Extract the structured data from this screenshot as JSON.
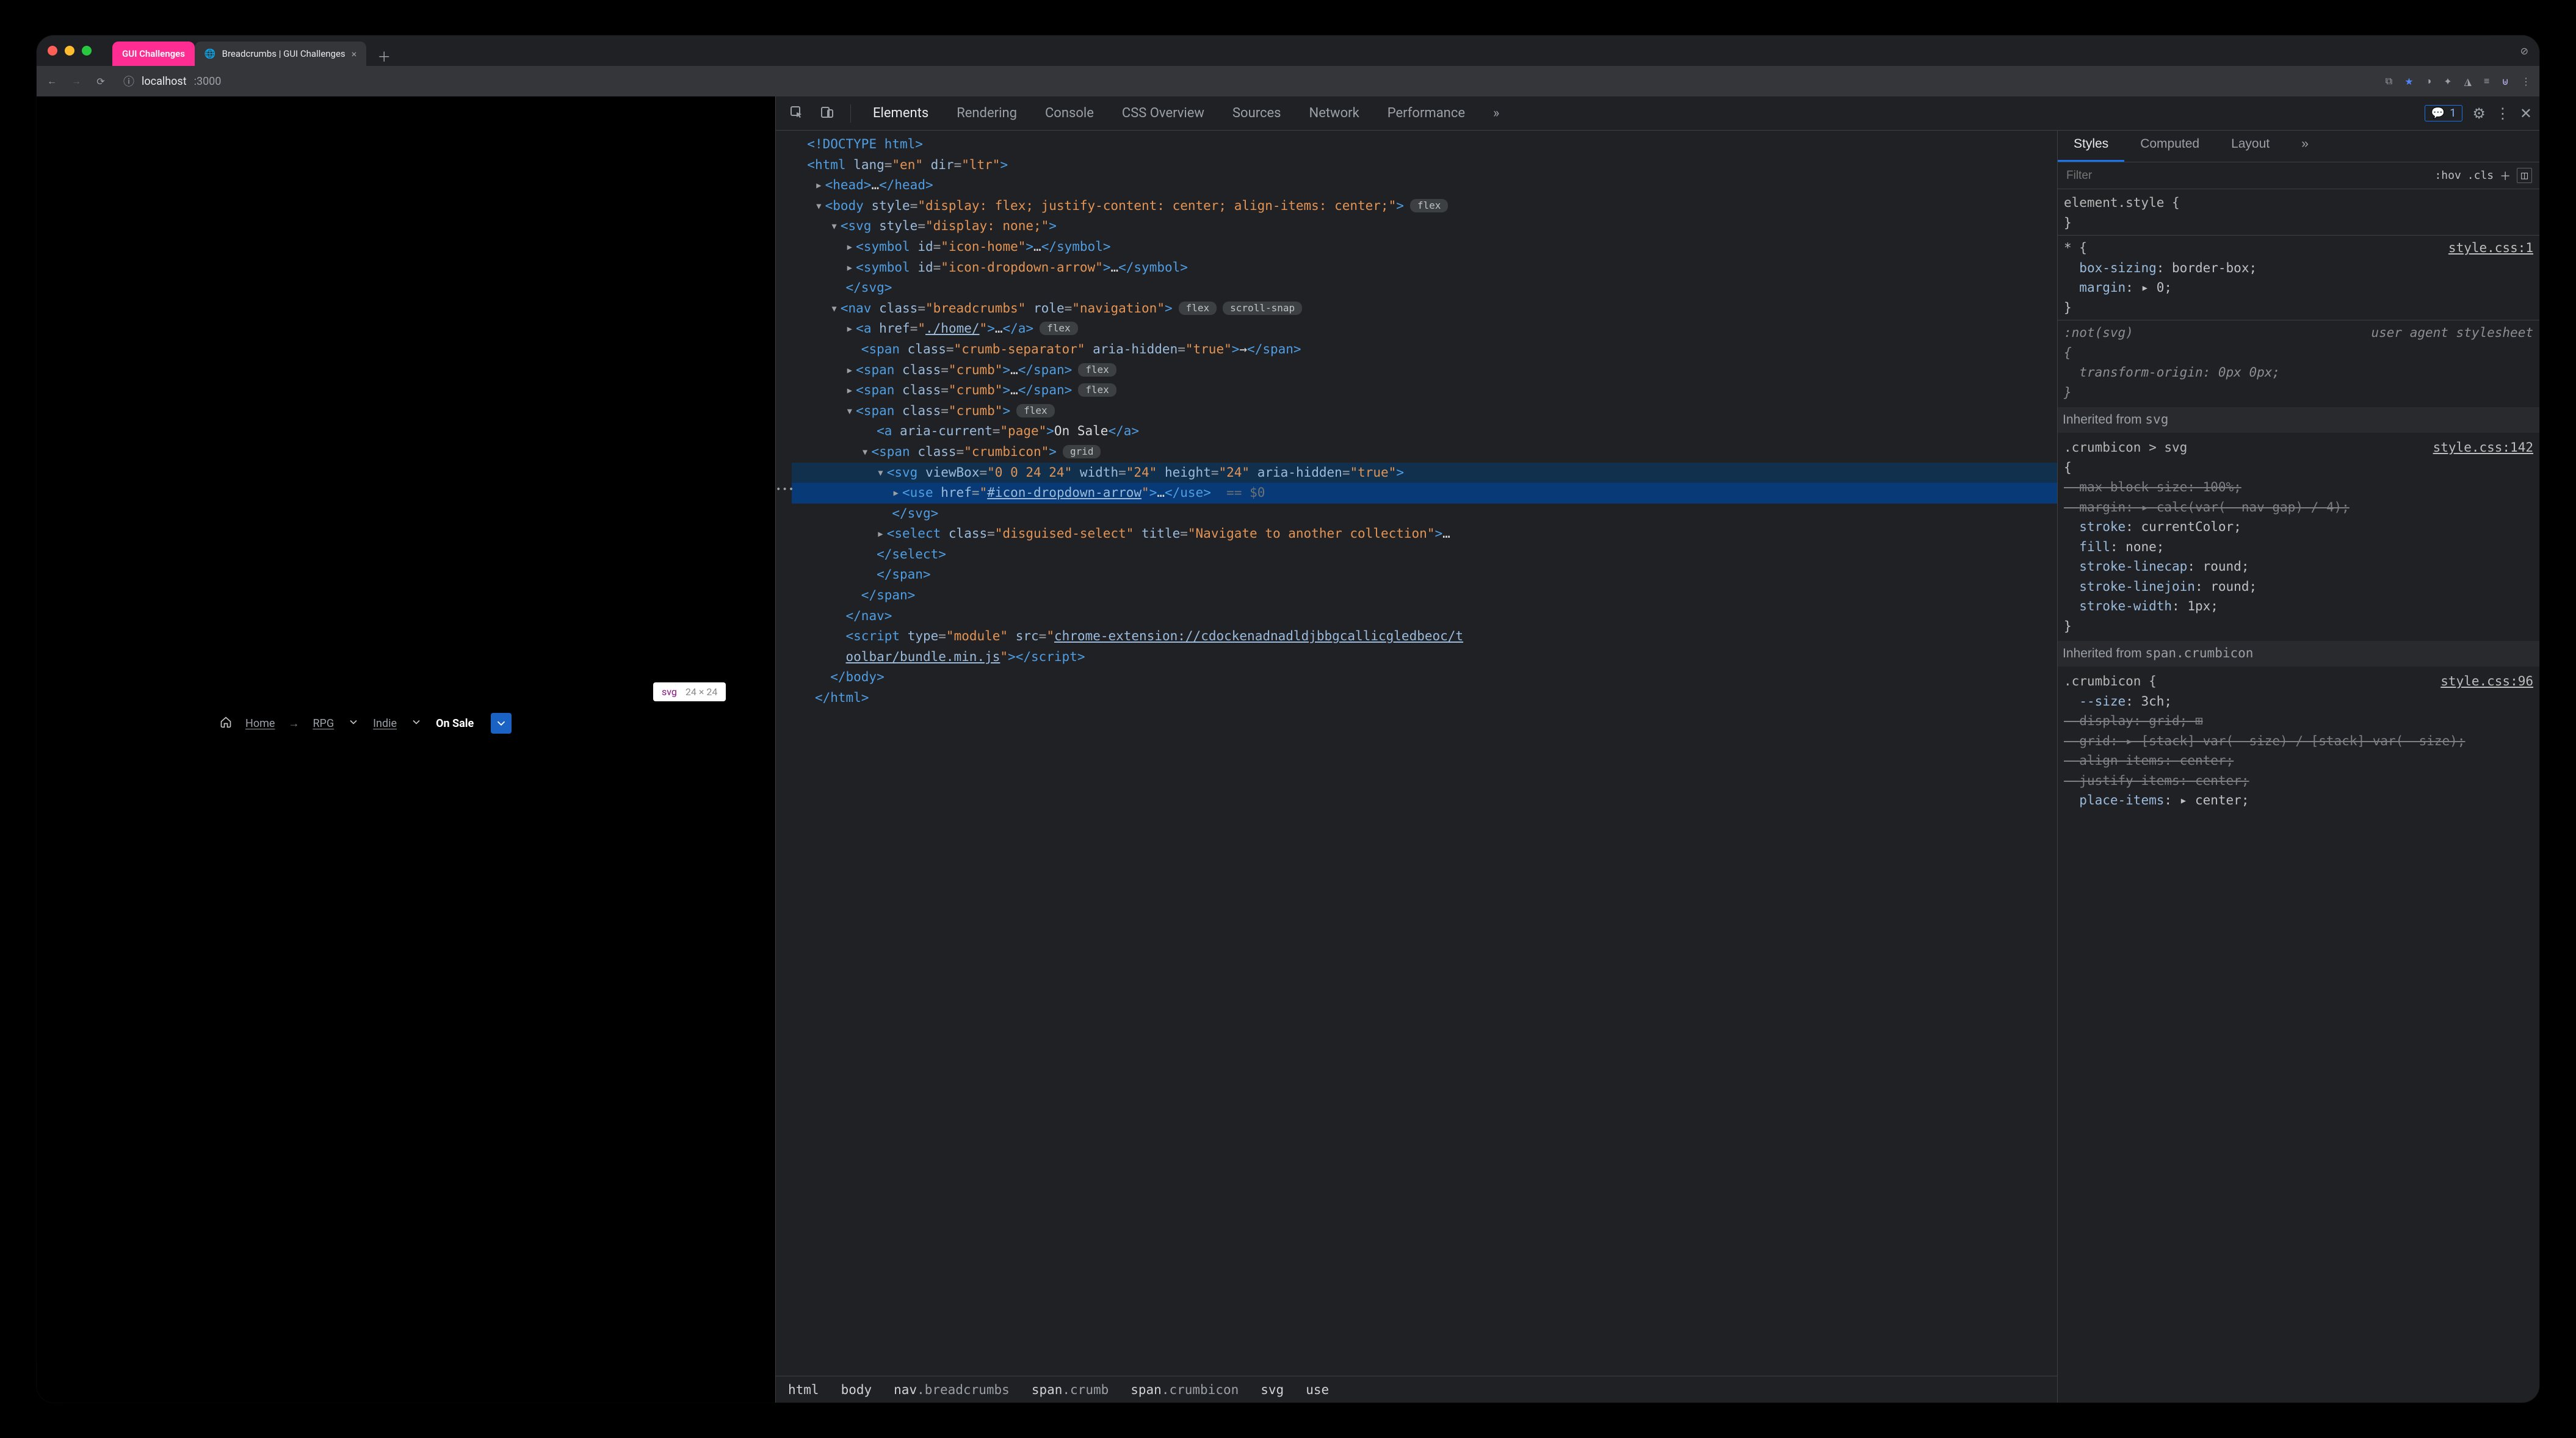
{
  "window": {
    "tabs": [
      {
        "label": "GUI Challenges",
        "type": "pink"
      },
      {
        "label": "Breadcrumbs | GUI Challenges",
        "type": "active"
      }
    ]
  },
  "address": {
    "host": "localhost",
    "port": ":3000"
  },
  "tooltip": {
    "tag": "svg",
    "dims": "24 × 24"
  },
  "breadcrumbs": {
    "home": "Home",
    "items": [
      "RPG",
      "Indie"
    ],
    "current": "On Sale"
  },
  "devtools": {
    "tabs": [
      "Elements",
      "Rendering",
      "Console",
      "CSS Overview",
      "Sources",
      "Network",
      "Performance"
    ],
    "issues": "1",
    "styles_tabs": [
      "Styles",
      "Computed",
      "Layout"
    ],
    "filter_placeholder": "Filter",
    "hov": ":hov",
    "cls": ".cls",
    "breadcrumb_path": [
      "html",
      "body",
      "nav",
      "breadcrumbs",
      "span",
      "crumb",
      "span",
      "crumbicon",
      "svg",
      "use"
    ]
  },
  "dom": {
    "doctype": "<!DOCTYPE html>",
    "html_open": "<html lang=\"en\" dir=\"ltr\">",
    "head": "<head>…</head>",
    "body_open": "<body style=\"display: flex; justify-content: center; align-items: center;\">",
    "svg_open": "<svg style=\"display: none;\">",
    "sym1": "<symbol id=\"icon-home\">…</symbol>",
    "sym2": "<symbol id=\"icon-dropdown-arrow\">…</symbol>",
    "svg_close": "</svg>",
    "nav_open": "<nav class=\"breadcrumbs\" role=\"navigation\">",
    "a_home": "<a href=\"./home/\">…</a>",
    "sep": "<span class=\"crumb-separator\" aria-hidden=\"true\">→</span>",
    "crumb": "<span class=\"crumb\">…</span>",
    "crumb_open": "<span class=\"crumb\">",
    "a_current": "<a aria-current=\"page\">On Sale</a>",
    "crumbicon_open": "<span class=\"crumbicon\">",
    "svg_el": "<svg viewBox=\"0 0 24 24\" width=\"24\" height=\"24\" aria-hidden=\"true\">",
    "use_el": "<use href=\"#icon-dropdown-arrow\">…</use>  == $0",
    "svg_el_close": "</svg>",
    "select": "<select class=\"disguised-select\" title=\"Navigate to another collection\">…",
    "select_close": "</select>",
    "span_close": "</span>",
    "nav_close": "</nav>",
    "script": "<script type=\"module\" src=\"chrome-extension://cdockenadnadldjbbgcallicgledbeoc/toolbar/bundle.min.js\"></script>",
    "body_close": "</body>",
    "html_close": "</html>"
  },
  "styles": {
    "element_style": "element.style {",
    "star": "* {",
    "star_src": "style.css:1",
    "bs": "box-sizing",
    "bsv": "border-box;",
    "mg": "margin",
    "mgv": "▸ 0;",
    "notsvg": ":not(svg)",
    "uas": "user agent stylesheet",
    "to": "transform-origin",
    "tov": "0px 0px;",
    "inh1": "Inherited from ",
    "inh1m": "svg",
    "r1_sel": ".crumbicon > svg",
    "r1_src": "style.css:142",
    "mbs": "max-block-size",
    "mbsv": "100%;",
    "mg2v": "▸ calc(var(--nav-gap) / 4);",
    "stroke": "stroke",
    "strokev": "currentColor;",
    "fill": "fill",
    "fillv": "none;",
    "slc": "stroke-linecap",
    "slcv": "round;",
    "slj": "stroke-linejoin",
    "sljv": "round;",
    "sw": "stroke-width",
    "swv": "1px;",
    "inh2": "Inherited from ",
    "inh2m": "span.crumbicon",
    "r2_sel": ".crumbicon {",
    "r2_src": "style.css:96",
    "size": "--size",
    "sizev": "3ch;",
    "disp": "display",
    "dispv": "grid; ⊞",
    "grid": "grid",
    "gridv": "▸ [stack] var(--size) / [stack] var(--size);",
    "ai": "align-items",
    "aiv": "center;",
    "ji": "justify-items",
    "jiv": "center;",
    "pi": "place-items",
    "piv": "▸ center;"
  }
}
